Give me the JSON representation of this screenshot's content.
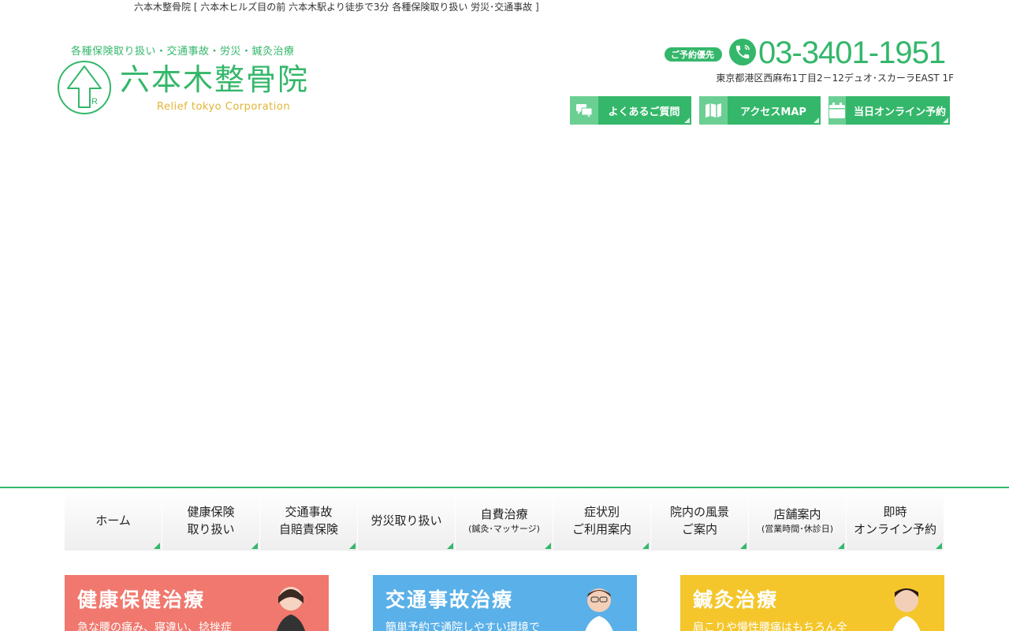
{
  "header": {
    "tagline": "六本木整骨院 [ 六本木ヒルズ目の前 六本木駅より徒歩で3分 各種保険取り扱い 労災･交通事故 ]",
    "logo_sub": "各種保険取り扱い・交通事故・労災・鍼灸治療",
    "logo_name": "六本木整骨院",
    "logo_en": "Relief tokyo Corporation",
    "phone_badge": "ご予約優先",
    "phone_number": "03-3401-1951",
    "address": "東京都港区西麻布1丁目2－12デュオ･スカーラEAST 1F"
  },
  "top_buttons": [
    {
      "label": "よくあるご質問",
      "icon": "chat-icon"
    },
    {
      "label": "アクセスMAP",
      "icon": "map-icon"
    },
    {
      "label": "当日オンライン予約",
      "icon": "calendar-icon"
    }
  ],
  "nav": [
    {
      "line1": "ホーム",
      "line2": ""
    },
    {
      "line1": "健康保険",
      "line2": "取り扱い"
    },
    {
      "line1": "交通事故",
      "line2": "自賠責保険"
    },
    {
      "line1": "労災取り扱い",
      "line2": ""
    },
    {
      "line1": "自費治療",
      "sub": "(鍼灸･マッサージ)"
    },
    {
      "line1": "症状別",
      "line2": "ご利用案内"
    },
    {
      "line1": "院内の風景",
      "line2": "ご案内"
    },
    {
      "line1": "店舗案内",
      "sub": "(営業時間･休診日)"
    },
    {
      "line1": "即時",
      "line2": "オンライン予約"
    }
  ],
  "banners": [
    {
      "title": "健康保健治療",
      "desc": "急な腰の痛み、寝違い、捻挫症",
      "color": "#f0786e"
    },
    {
      "title": "交通事故治療",
      "desc": "簡単予約で通院しやすい環境で",
      "color": "#5ab0e8"
    },
    {
      "title": "鍼灸治療",
      "desc": "肩こりや慢性腰痛はもちろん全",
      "color": "#f4c62b"
    }
  ],
  "colors": {
    "brand": "#34b76a",
    "accent": "#e2b336"
  }
}
